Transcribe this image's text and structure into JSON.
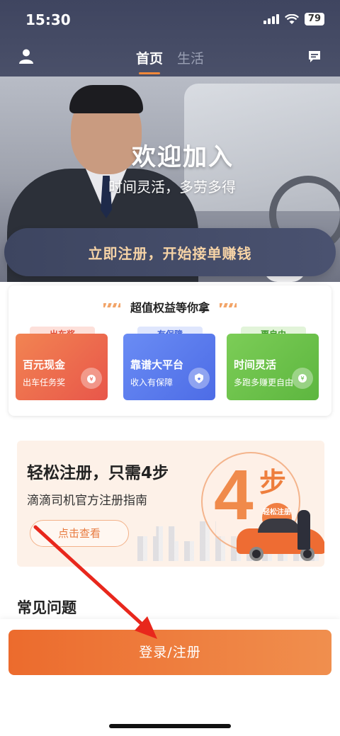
{
  "status_bar": {
    "time": "15:30",
    "battery": "79"
  },
  "nav": {
    "tabs": [
      {
        "label": "首页",
        "active": true
      },
      {
        "label": "生活",
        "active": false
      }
    ]
  },
  "hero": {
    "title": "欢迎加入",
    "subtitle": "时间灵活，多劳多得"
  },
  "cta": {
    "label": "立即注册，开始接单赚钱"
  },
  "benefits": {
    "title": "超值权益等你拿",
    "cards": [
      {
        "tag": "出车奖",
        "title": "百元现金",
        "desc": "出车任务奖",
        "color": "#ee6c45"
      },
      {
        "tag": "有保障",
        "title": "靠谱大平台",
        "desc": "收入有保障",
        "color": "#5b7ef0"
      },
      {
        "tag": "更自由",
        "title": "时间灵活",
        "desc": "多跑多赚更自由",
        "color": "#6cc04a"
      }
    ]
  },
  "guide": {
    "title": "轻松注册，只需4步",
    "subtitle": "滴滴司机官方注册指南",
    "button": "点击查看",
    "graphic_number": "4",
    "graphic_word": "步",
    "badge": "轻松注册"
  },
  "faq": {
    "title": "常见问题"
  },
  "footer": {
    "login_label": "登录/注册"
  },
  "colors": {
    "brand_orange": "#ef7a3c",
    "header_navy": "#424862",
    "cta_gold": "#f6d3a6",
    "annotation_red": "#e8271c"
  },
  "icons": {
    "profile": "user-icon",
    "message": "message-icon"
  }
}
